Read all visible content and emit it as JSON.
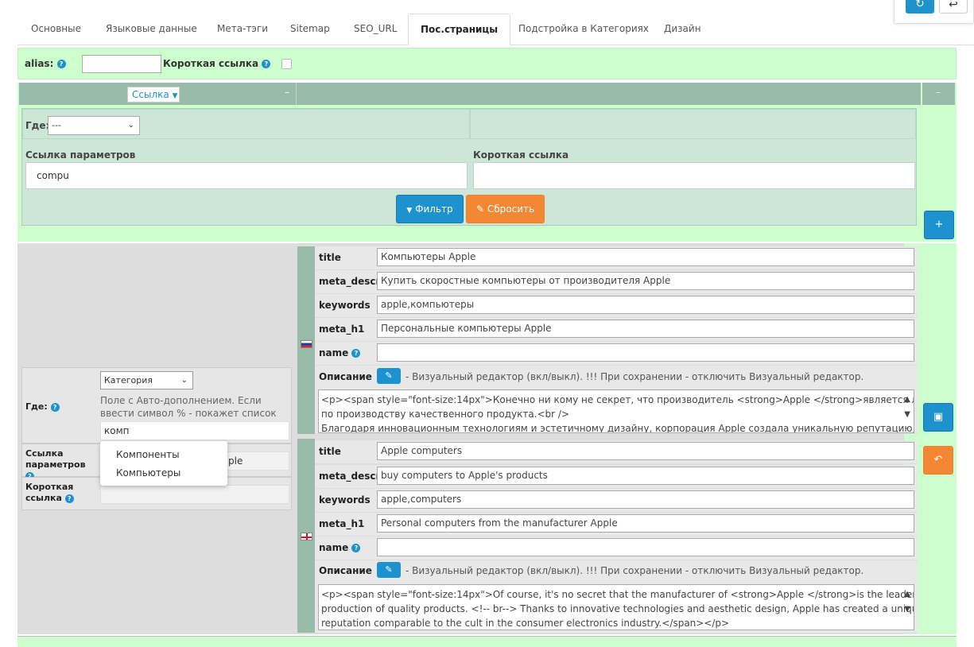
{
  "tabs": [
    {
      "label": "Основные"
    },
    {
      "label": "Языковые данные"
    },
    {
      "label": "Мета-тэги"
    },
    {
      "label": "Sitemap"
    },
    {
      "label": "SEO_URL"
    },
    {
      "label": "Пос.страницы"
    },
    {
      "label": "Подстройка в Категориях"
    },
    {
      "label": "Дизайн"
    }
  ],
  "top": {
    "alias_label": "alias:",
    "short_link_label": "Короткая ссылка",
    "help_glyph": "?"
  },
  "filter": {
    "link_select": "Ссылка",
    "where_label": "Где:",
    "where_value": "---",
    "params_label": "Ссылка параметров",
    "params_value": "compu",
    "short_label": "Короткая ссылка",
    "short_value": "",
    "filter_btn": "Фильтр",
    "reset_btn": "Сбросить",
    "collapse": "–"
  },
  "record": {
    "where_label": "Где:",
    "where_value": "Категория",
    "where_note": "Поле с Авто-дополнением. Если ввести символ % - покажет список",
    "autocomplete_value": "комп",
    "params_label": "Ссылка параметров",
    "params_value_partial": "ple",
    "short_label": "Короткая ссылка",
    "suggestions": [
      "Компоненты",
      "Компьютеры"
    ]
  },
  "ru": {
    "title_label": "title",
    "title_value": "Компьютеры Apple",
    "meta_descr_label": "meta_descr",
    "meta_descr_value": "Купить скоростные компьютеры от производителя Apple",
    "keywords_label": "keywords",
    "keywords_value": "apple,компьютеры",
    "meta_h1_label": "meta_h1",
    "meta_h1_value": "Персональные компьютеры Apple",
    "name_label": "name",
    "name_value": "",
    "desc_label": "Описание",
    "desc_note": "- Визуальный редактор (вкл/выкл). !!! При сохранении - отключить Визуальный редактор.",
    "text_line1": "<p><span style=\"font-size:14px\">Конечно ни кому не секрет, что производитель <strong>Apple </strong>является лидером",
    "text_line2": "по производству качественного продукта.<br />",
    "text_line3": "Благодаря инновационным технологиям и эстетичному дизайну, корпорация Apple создала уникальную репутацию,"
  },
  "en": {
    "title_label": "title",
    "title_value": "Apple computers",
    "meta_descr_label": "meta_descr",
    "meta_descr_value": "buy computers to Apple's products",
    "keywords_label": "keywords",
    "keywords_value": "apple,computers",
    "meta_h1_label": "meta_h1",
    "meta_h1_value": "Personal computers from the manufacturer Apple",
    "name_label": "name",
    "name_value": "",
    "desc_label": "Описание",
    "desc_note": "- Визуальный редактор (вкл/выкл). !!! При сохранении - отключить Визуальный редактор.",
    "text_line1": "<p><span style=\"font-size:14px\">Of course, it's no secret that the manufacturer of <strong>Apple </strong>is the leader in the",
    "text_line2": "production of quality products. <!-- br--> Thanks to innovative technologies and aesthetic design, Apple has created a unique",
    "text_line3": "reputation comparable to the cult in the consumer electronics industry.</span></p>"
  },
  "icons": {
    "filter": "▼",
    "eraser": "✎",
    "plus": "+",
    "save": "▣",
    "undo": "↶",
    "refresh": "↻",
    "back": "↩",
    "pencil": "✎",
    "chevron": "⌄"
  },
  "colors": {
    "green_bg": "#ccffcc",
    "header_bg": "#99bbaa",
    "primary": "#1e91cf",
    "warning": "#f38733"
  }
}
